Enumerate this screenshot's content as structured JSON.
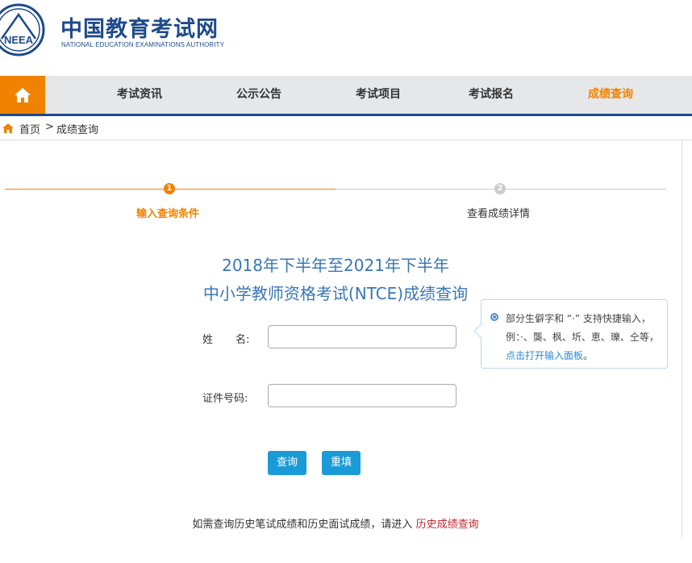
{
  "brand": {
    "title": "中国教育考试网",
    "subtitle": "NATIONAL EDUCATION EXAMINATIONS AUTHORITY",
    "logo_text": "NEEA"
  },
  "nav": {
    "home_icon": "home-icon",
    "items": [
      {
        "label": "考试资讯"
      },
      {
        "label": "公示公告"
      },
      {
        "label": "考试项目"
      },
      {
        "label": "考试报名"
      },
      {
        "label": "成绩查询"
      }
    ],
    "active_color": "#f08200",
    "accent": "#1e4a8a"
  },
  "breadcrumb": {
    "home": "首页",
    "separator": ">",
    "current": "成绩查询"
  },
  "steps": [
    {
      "number": "1",
      "label": "输入查询条件",
      "state": "active"
    },
    {
      "number": "2",
      "label": "查看成绩详情",
      "state": "inactive"
    }
  ],
  "form": {
    "title_line1": "2018年下半年至2021年下半年",
    "title_line2": "中小学教师资格考试(NTCE)成绩查询",
    "name_label_a": "姓",
    "name_label_b": "名:",
    "name_value": "",
    "id_label": "证件号码:",
    "id_value": "",
    "query_button": "查询",
    "reset_button": "重填"
  },
  "tip": {
    "text_before": "部分生僻字和 “·” 支持快捷输入，例：·、龑、枫、圻、恵、瓅、仝等，",
    "link": "点击打开输入面板",
    "text_after": "。"
  },
  "footer_note": {
    "text": "如需查询历史笔试成绩和历史面试成绩，请进入",
    "link": "历史成绩查询"
  }
}
